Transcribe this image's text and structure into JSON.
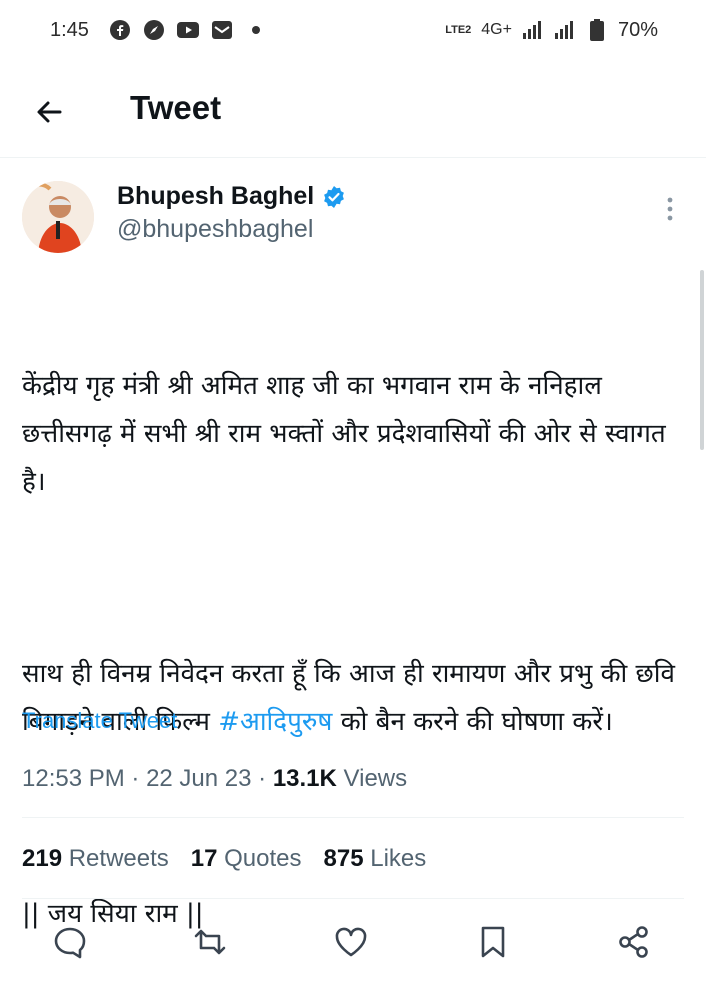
{
  "status_bar": {
    "time": "1:45",
    "network": "4G+",
    "lte_label": "LTE2",
    "battery": "70%",
    "icons": [
      "facebook-icon",
      "compass-icon",
      "youtube-icon",
      "mail-icon",
      "dot-icon"
    ]
  },
  "header": {
    "title": "Tweet"
  },
  "tweet": {
    "author_name": "Bhupesh Baghel",
    "author_handle": "@bhupeshbaghel",
    "paragraph_1": "केंद्रीय गृह मंत्री श्री अमित शाह जी का भगवान राम के ननिहाल छत्तीसगढ़ में सभी श्री राम भक्तों और प्रदेशवासियों की ओर से स्वागत है।",
    "paragraph_2_before": "साथ ही विनम्र निवेदन करता हूँ कि आज ही रामायण और प्रभु की छवि बिगाड़ने वाली फिल्म ",
    "hashtag": "#आदिपुरुष",
    "paragraph_2_after": " को बैन करने की घोषणा करें।",
    "paragraph_3": "|| जय सिया राम ||",
    "translate_label": "Translate Tweet",
    "time": "12:53 PM",
    "date": "22 Jun 23",
    "views_count": "13.1K",
    "views_label": "Views"
  },
  "stats": {
    "retweets_count": "219",
    "retweets_label": "Retweets",
    "quotes_count": "17",
    "quotes_label": "Quotes",
    "likes_count": "875",
    "likes_label": "Likes"
  },
  "colors": {
    "accent": "#1d9bf0",
    "text": "#0f1419",
    "secondary": "#536471"
  }
}
